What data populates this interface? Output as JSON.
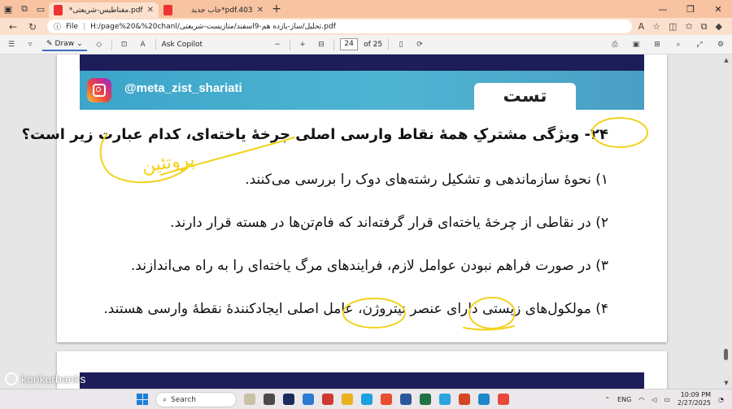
{
  "browser": {
    "tabs": [
      {
        "title": "pdf.مغناطیس-شریعتی*",
        "active": true
      },
      {
        "title": "pdf.403*جاب جدید",
        "active": false
      }
    ],
    "address": {
      "label": "File",
      "path": "H:/page%20&%20chanl/تحلیل/ساز-یازده هم-9اسفند/متازیست-شریعتی.pdf"
    }
  },
  "pdf_toolbar": {
    "draw_label": "Draw",
    "ask_copilot_label": "Ask Copilot",
    "zoom_out": "−",
    "zoom_in": "+",
    "current_page": "24",
    "page_total": "of 25"
  },
  "document": {
    "instagram_handle": "@meta_zist_shariati",
    "section_tab": "تست",
    "question": "۲۴- ویژگی مشترکِ همهٔ نقاط وارسی اصلی چرخهٔ یاخته‌ای، کدام عبارت زیر است؟",
    "options": [
      "۱) نحوهٔ سازماندهی و تشکیل رشته‌های دوک را بررسی می‌کنند.",
      "۲) در نقاطی از چرخهٔ یاخته‌ای قرار گرفته‌اند که فام‌تن‌ها در هسته قرار دارند.",
      "۳) در صورت فراهم نبودن عوامل لازم، فرایندهای مرگ یاخته‌ای را به راه می‌اندازند.",
      "۴) مولکول‌های زیستی دارای عنصر نیتروژن، عامل اصلی ایجادکنندهٔ نقطهٔ وارسی هستند."
    ],
    "handwritten_note": "پروتئین",
    "annotation_color": "#f2d21b"
  },
  "watermark": "konkurbanks",
  "taskbar": {
    "search_placeholder": "Search",
    "lang": "ENG",
    "time": "10:09 PM",
    "date": "2/27/2025"
  }
}
